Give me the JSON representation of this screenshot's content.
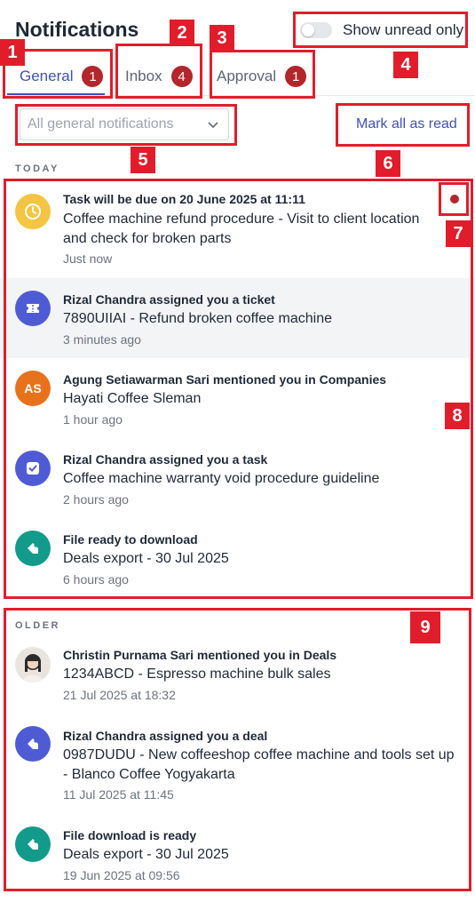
{
  "header": {
    "title": "Notifications",
    "toggle_label": "Show unread only"
  },
  "tabs": [
    {
      "label": "General",
      "count": "1"
    },
    {
      "label": "Inbox",
      "count": "4"
    },
    {
      "label": "Approval",
      "count": "1"
    }
  ],
  "filter": {
    "selected": "All general notifications",
    "mark_all": "Mark all as read"
  },
  "sections": {
    "today": "TODAY",
    "older": "OLDER"
  },
  "today": [
    {
      "heading": "Task will be due on 20 June 2025 at 11:11",
      "body": "Coffee machine refund procedure - Visit to client location and check for broken parts",
      "time": "Just now",
      "icon": "clock-icon"
    },
    {
      "heading": "Rizal Chandra assigned you a ticket",
      "body": "7890UIIAI - Refund broken coffee machine",
      "time": "3 minutes ago",
      "icon": "ticket-icon"
    },
    {
      "heading": "Agung Setiawarman Sari mentioned you in Companies",
      "body": "Hayati Coffee Sleman",
      "time": "1 hour ago",
      "initials": "AS"
    },
    {
      "heading": "Rizal Chandra assigned you a task",
      "body": "Coffee machine warranty void procedure guideline",
      "time": "2 hours ago",
      "icon": "task-check-icon"
    },
    {
      "heading": "File ready to download",
      "body": "Deals export - 30 Jul 2025",
      "time": "6 hours ago",
      "icon": "download-tag-icon"
    }
  ],
  "older": [
    {
      "heading": "Christin Purnama Sari mentioned you in Deals",
      "body": "1234ABCD - Espresso machine bulk sales",
      "time": "21 Jul 2025 at 18:32",
      "icon": "user-photo"
    },
    {
      "heading": "Rizal Chandra assigned you a deal",
      "body": "0987DUDU - New coffeeshop coffee machine and tools set up - Blanco Coffee Yogyakarta",
      "time": "11 Jul 2025 at 11:45",
      "icon": "deal-tag-icon"
    },
    {
      "heading": "File download is ready",
      "body": "Deals export - 30 Jul 2025",
      "time": "19 Jun 2025 at 09:56",
      "icon": "download-tag-icon"
    }
  ],
  "annotations": [
    "1",
    "2",
    "3",
    "4",
    "5",
    "6",
    "7",
    "8",
    "9"
  ],
  "colors": {
    "accent": "#3f51b5",
    "badge": "#b3262b",
    "annotation": "#e11d2b",
    "yellow": "#f4c542",
    "indigo": "#4f5bd5",
    "orange": "#e8711c",
    "teal": "#129a8a"
  }
}
